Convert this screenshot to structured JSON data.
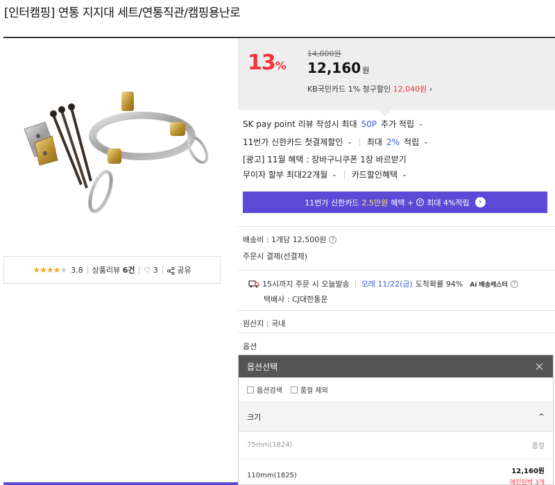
{
  "product": {
    "title": "[인터캠핑] 연통 지지대 세트/연통직관/캠핑용난로"
  },
  "review": {
    "stars": "★★★★",
    "stars_off": "★",
    "rating": "3.8",
    "review_label": "상품리뷰",
    "review_count": "6건",
    "heart": "♡",
    "likes": "3",
    "share_label": "공유"
  },
  "price": {
    "discount": "13",
    "discount_unit": "%",
    "original": "14,000원",
    "sale": "12,160",
    "sale_unit": "원",
    "card_text": "KB국민카드 1% 청구할인",
    "card_price": "12,040원",
    "card_arrow": "›"
  },
  "benefits": {
    "sk_prefix": "SK pay point 리뷰 작성시 최대",
    "sk_points": "50P",
    "sk_suffix": "추가 적립",
    "card1": "11번가 신한카드 첫결제할인",
    "max_label": "최대",
    "max_rate": "2%",
    "max_suffix": "적립",
    "ad": "[광고] 11월 혜택 : 장바구니쿠폰 1장 바르받기",
    "installment": "무이자 할부 최대22개월",
    "card_discount": "카드할인혜택",
    "chevron": "⌄"
  },
  "banner": {
    "prefix": "11번가 신한카드",
    "amount": "2.5만원",
    "mid": "혜택 +",
    "p": "P",
    "suffix": "최대 4%적립",
    "go": "›"
  },
  "shipping": {
    "fee_label": "배송비 : 1개당 12,500원",
    "qmark": "?",
    "pay_label": "주문시 결제(선결제)",
    "today": "15시까지 주문 시 오늘발송",
    "eta_prefix": "모레 11/22(금)",
    "eta_suffix": "도착확률 94%",
    "ai_label": "Ai 배송캐스터",
    "courier": "택배사 : CJ대한통운",
    "origin": "원산지 : 국내",
    "option_label": "옵션"
  },
  "option_panel": {
    "header": "옵션선택",
    "close": "×",
    "filter_search": "옵션검색",
    "filter_soldout": "품절 제외",
    "group": "크기",
    "group_arrow": "^",
    "items": [
      {
        "name": "75mm(1824)",
        "status": "품절"
      },
      {
        "name": "110mm(1825)",
        "price": "12,160원",
        "stock": "매진임박 3개"
      }
    ]
  }
}
